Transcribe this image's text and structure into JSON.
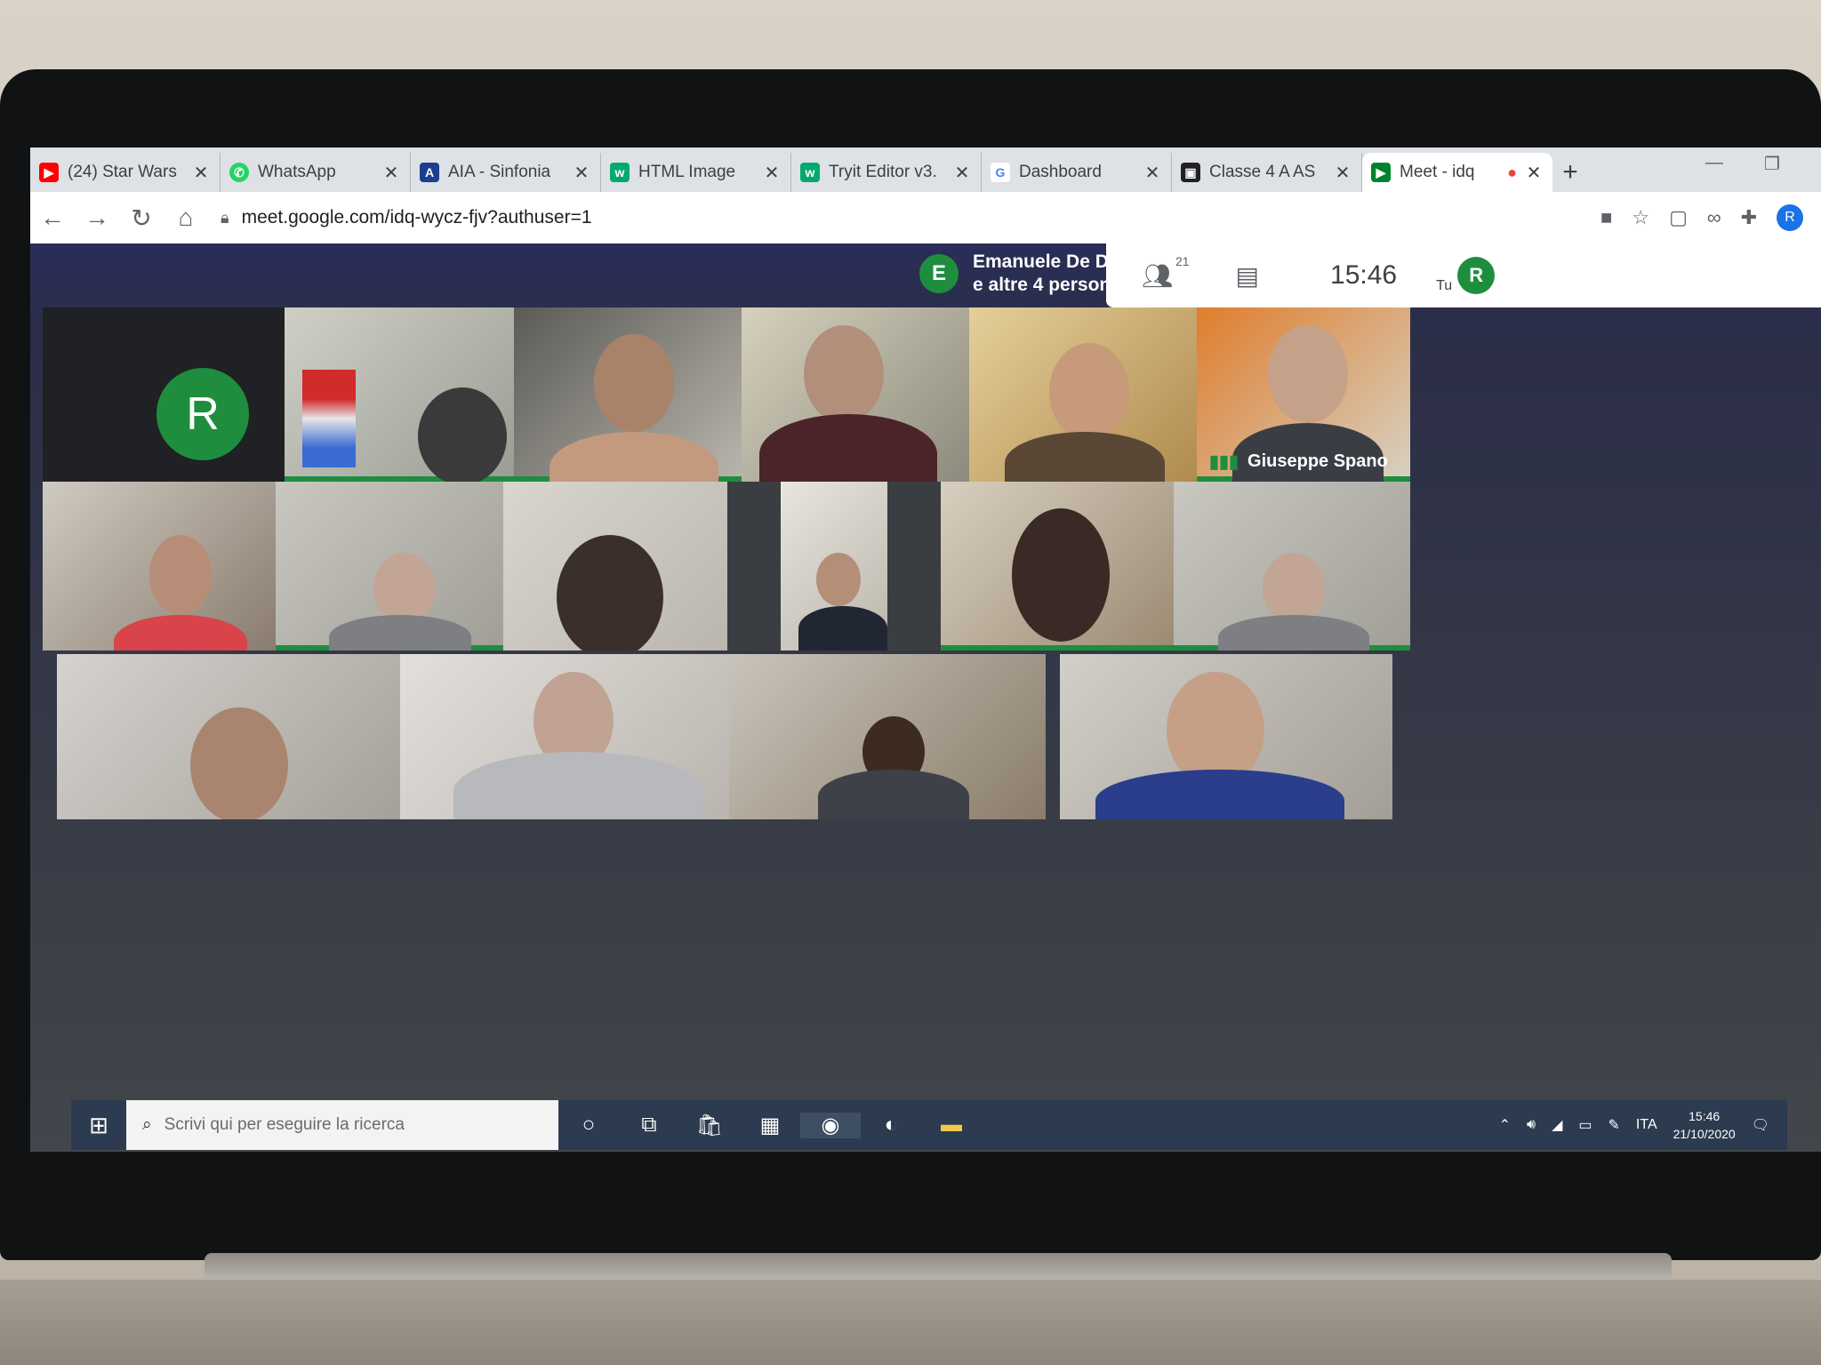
{
  "browser": {
    "tabs": [
      {
        "title": "(24) Star Wars",
        "icon": "youtube-icon",
        "color": "#ff0000"
      },
      {
        "title": "WhatsApp",
        "icon": "whatsapp-icon",
        "color": "#25d366"
      },
      {
        "title": "AIA - Sinfonia",
        "icon": "aia-icon",
        "color": "#1b3f8f"
      },
      {
        "title": "HTML Image",
        "icon": "w3schools-icon",
        "color": "#04aa6d"
      },
      {
        "title": "Tryit Editor v3.",
        "icon": "w3schools-icon",
        "color": "#04aa6d"
      },
      {
        "title": "Dashboard",
        "icon": "google-icon",
        "color": "#4285f4"
      },
      {
        "title": "Classe 4 A AS",
        "icon": "classroom-icon",
        "color": "#202124"
      },
      {
        "title": "Meet - idq",
        "icon": "meet-icon",
        "color": "#00832d",
        "active": true
      }
    ],
    "url": "meet.google.com/idq-wycz-fjv?authuser=1",
    "profile_initial": "R"
  },
  "meet": {
    "presenter_initial": "E",
    "presenter_line1": "Emanuele De D...",
    "presenter_line2": "e altre 4 persone",
    "participant_count": "21",
    "time": "15:46",
    "you_label": "Tu",
    "you_initial": "R",
    "self_tile_initial": "R",
    "named_participant": "Giuseppe Spano"
  },
  "taskbar": {
    "search_placeholder": "Scrivi qui per eseguire la ricerca",
    "lang": "ITA",
    "time": "15:46",
    "date": "21/10/2020"
  }
}
